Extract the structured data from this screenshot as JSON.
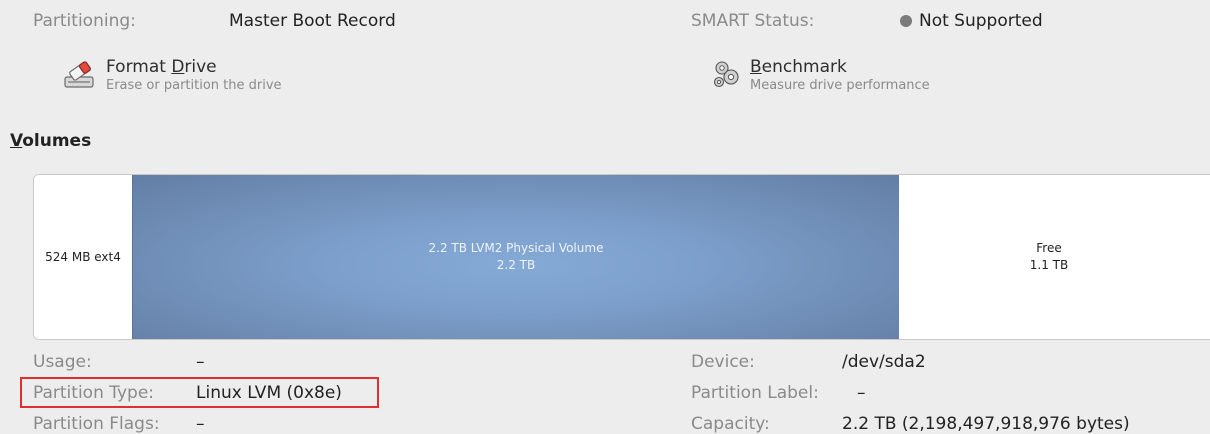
{
  "top_row": {
    "partitioning_label": "Partitioning:",
    "partitioning_value": "Master Boot Record",
    "smart_label": "SMART Status:",
    "smart_value": "Not Supported"
  },
  "actions": {
    "format": {
      "title_prefix": "Format ",
      "title_mnemonic": "D",
      "title_rest": "rive",
      "subtitle": "Erase or partition the drive",
      "icon": "eraser-icon"
    },
    "benchmark": {
      "title_mnemonic": "B",
      "title_rest": "enchmark",
      "subtitle": "Measure drive performance",
      "icon": "gears-icon"
    }
  },
  "volumes": {
    "title_mnemonic": "V",
    "title_rest": "olumes",
    "segments": [
      {
        "id": "ext4",
        "line1": "524 MB ext4",
        "line2": ""
      },
      {
        "id": "lvm",
        "line1": "2.2 TB LVM2 Physical Volume",
        "line2": "2.2 TB"
      },
      {
        "id": "free",
        "line1": "Free",
        "line2": "1.1 TB"
      }
    ],
    "selected_color": "#7c9fcb"
  },
  "details": {
    "usage_label": "Usage:",
    "usage_value": "–",
    "partition_type_label": "Partition Type:",
    "partition_type_value": "Linux LVM (0x8e)",
    "partition_flags_label": "Partition Flags:",
    "partition_flags_value": "–",
    "device_label": "Device:",
    "device_value": "/dev/sda2",
    "partition_label_label": "Partition Label:",
    "partition_label_value": "–",
    "capacity_label": "Capacity:",
    "capacity_value": "2.2 TB (2,198,497,918,976 bytes)"
  },
  "colors": {
    "highlight": "#e0302e",
    "background": "#ededed"
  }
}
